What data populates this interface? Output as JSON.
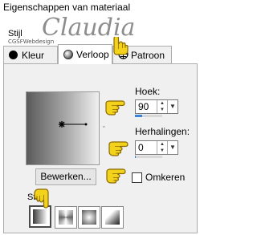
{
  "window": {
    "title": "Eigenschappen van materiaal"
  },
  "style_label": "Stijl",
  "watermark": {
    "signature": "Claudia",
    "small_text": "CGSFWebdesign"
  },
  "tabs": [
    {
      "label": "Kleur"
    },
    {
      "label": "Verloop"
    },
    {
      "label": "Patroon"
    }
  ],
  "gradient": {
    "angle_label": "Hoek:",
    "angle_value": "90",
    "repeats_label": "Herhalingen:",
    "repeats_value": "0",
    "edit_button": "Bewerken...",
    "invert_label": "Omkeren",
    "invert_checked": false,
    "style_label": "Stijl",
    "styles": [
      "linear",
      "radial",
      "circular",
      "rectangular"
    ],
    "selected_style": "linear"
  },
  "colors": {
    "accent": "#3c84d8",
    "hand": "#f2d21a",
    "hand_outline": "#8a6a00"
  }
}
